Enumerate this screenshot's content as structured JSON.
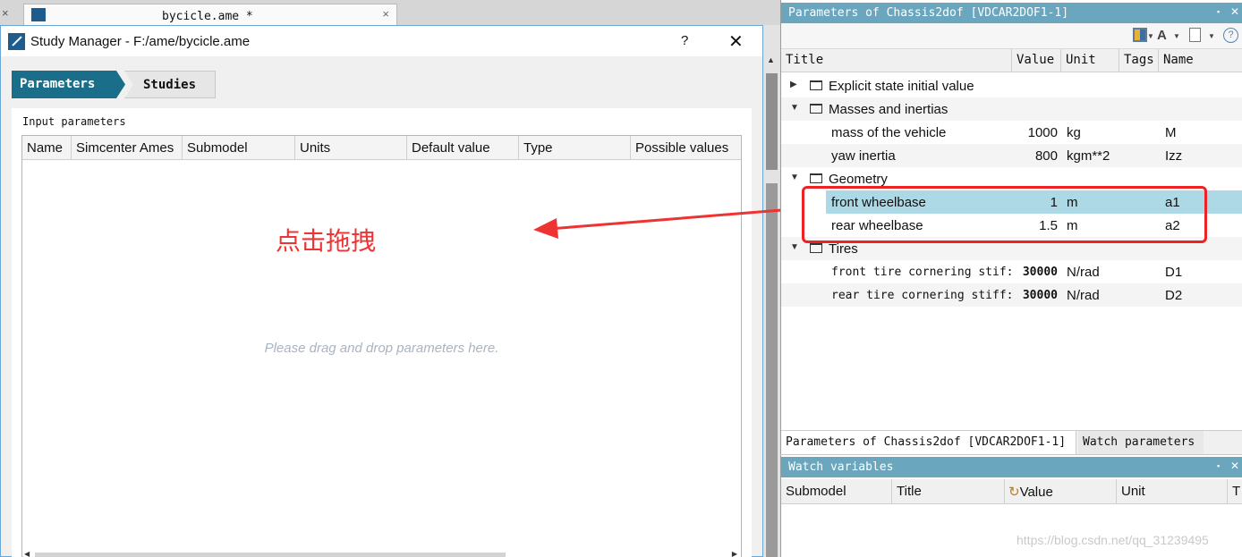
{
  "doc_tab": {
    "title": "bycicle.ame *",
    "close": "×",
    "side_close": "×"
  },
  "dialog": {
    "title": "Study Manager - F:/ame/bycicle.ame",
    "help": "?",
    "close": "✕",
    "tabs": [
      {
        "label": "Parameters"
      },
      {
        "label": "Studies"
      }
    ],
    "input_params_label": "Input parameters",
    "columns": [
      "Name",
      "Simcenter Ames",
      "Submodel",
      "Units",
      "Default value",
      "Type",
      "Possible values"
    ],
    "drop_hint": "Please drag and drop parameters here.",
    "tab_active_color": "#1a6e8a"
  },
  "annotation": {
    "text": "点击拖拽",
    "color": "#ee3333"
  },
  "params_panel": {
    "title": "Parameters of Chassis2dof [VDCAR2DOF1-1]",
    "float_icon": "▪",
    "close": "✕",
    "toolbar": {
      "icons": [
        "layout-icon",
        "font-icon",
        "export-icon",
        "help-icon"
      ],
      "help_glyph": "?"
    },
    "columns": [
      "Title",
      "Value",
      "Unit",
      "Tags",
      "Name"
    ],
    "groups": [
      {
        "label": "Explicit state initial value",
        "expanded": false
      },
      {
        "label": "Masses and inertias",
        "expanded": true,
        "rows": [
          {
            "title": "mass of the vehicle",
            "value": "1000",
            "unit": "kg",
            "name": "M"
          },
          {
            "title": "yaw inertia",
            "value": "800",
            "unit": "kgm**2",
            "name": "Izz"
          }
        ]
      },
      {
        "label": "Geometry",
        "expanded": true,
        "rows": [
          {
            "title": "front wheelbase",
            "value": "1",
            "unit": "m",
            "name": "a1",
            "selected": true
          },
          {
            "title": "rear wheelbase",
            "value": "1.5",
            "unit": "m",
            "name": "a2"
          }
        ]
      },
      {
        "label": "Tires",
        "expanded": true,
        "rows": [
          {
            "title": "front tire cornering stif:",
            "value": "30000",
            "unit": "N/rad",
            "name": "D1"
          },
          {
            "title": "rear tire cornering stiff:",
            "value": "30000",
            "unit": "N/rad",
            "name": "D2"
          }
        ]
      }
    ],
    "bottom_tabs": [
      "Parameters of Chassis2dof [VDCAR2DOF1-1]",
      "Watch parameters"
    ],
    "selection_color": "#add8e6",
    "highlight_color": "#ee2222"
  },
  "watch_panel": {
    "title": "Watch variables",
    "columns": [
      "Submodel",
      "Title",
      "Value",
      "Unit",
      "T"
    ]
  },
  "watermark": "https://blog.csdn.net/qq_31239495"
}
